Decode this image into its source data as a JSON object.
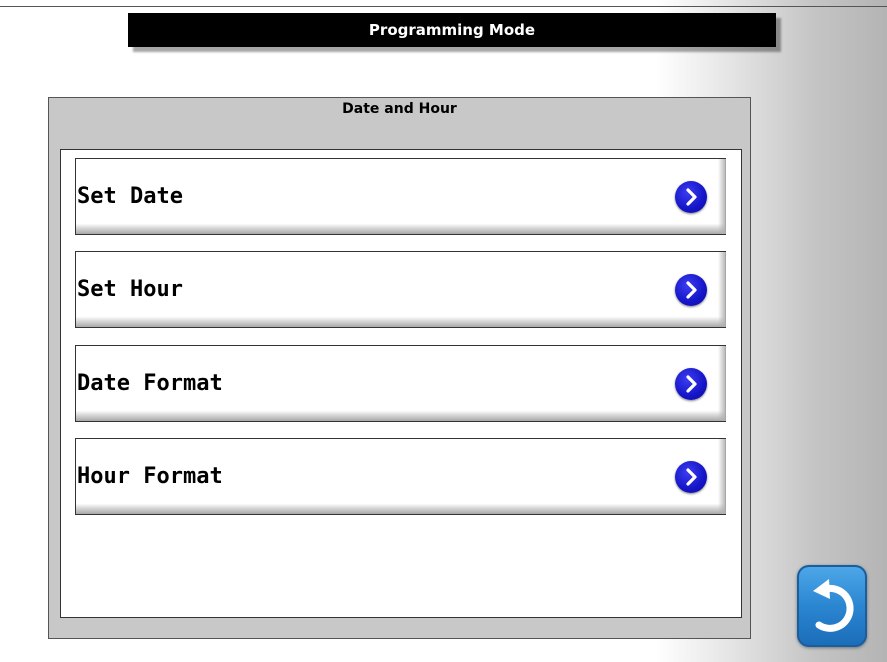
{
  "header": {
    "title": "Programming Mode"
  },
  "panel": {
    "title": "Date and Hour",
    "items": [
      {
        "label": "Set Date",
        "icon": "chevron-right-icon"
      },
      {
        "label": "Set Hour",
        "icon": "chevron-right-icon"
      },
      {
        "label": "Date Format",
        "icon": "chevron-right-icon"
      },
      {
        "label": "Hour Format",
        "icon": "chevron-right-icon"
      }
    ]
  },
  "footer": {
    "back_icon": "back-arrow-icon"
  },
  "colors": {
    "title_bar_bg": "#000000",
    "title_text": "#ffffff",
    "chevron_circle": "#1515c8",
    "back_button": "#2b86d2"
  }
}
